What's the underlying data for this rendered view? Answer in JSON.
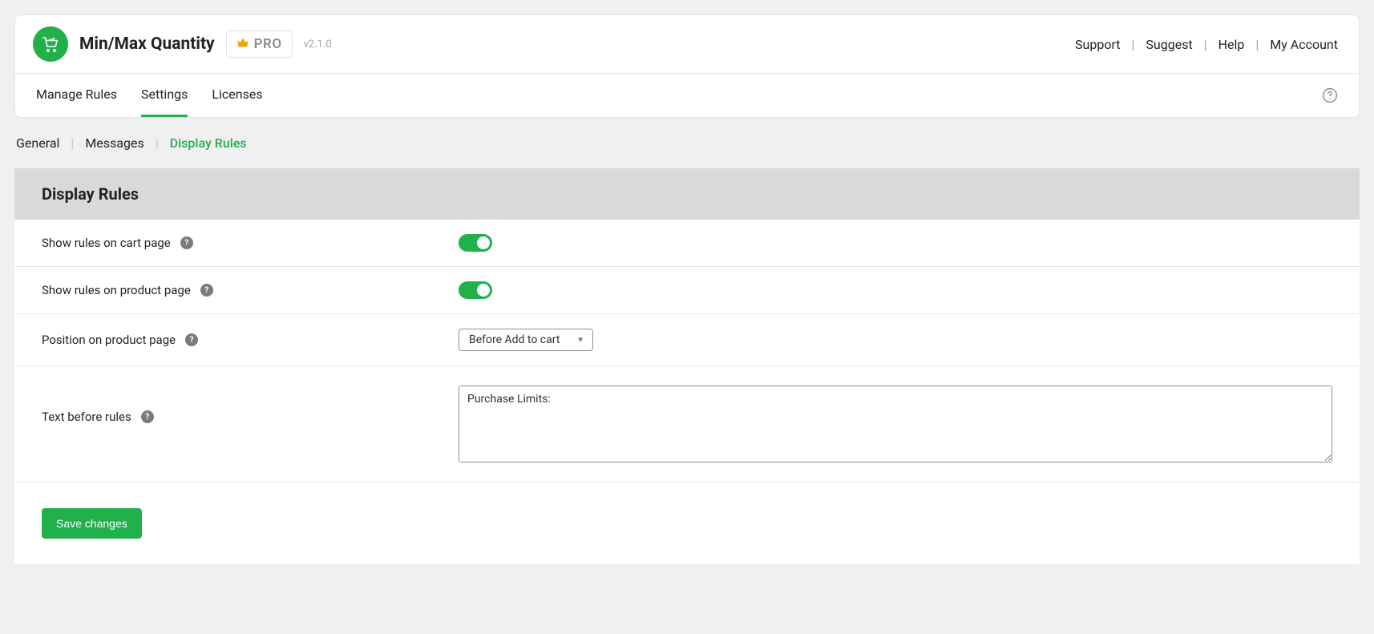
{
  "header": {
    "app_title": "Min/Max Quantity",
    "pro_label": "PRO",
    "version": "v2.1.0",
    "links": {
      "support": "Support",
      "suggest": "Suggest",
      "help": "Help",
      "my_account": "My Account"
    }
  },
  "nav": {
    "manage_rules": "Manage Rules",
    "settings": "Settings",
    "licenses": "Licenses"
  },
  "subnav": {
    "general": "General",
    "messages": "Messages",
    "display_rules": "Display Rules"
  },
  "panel": {
    "title": "Display Rules",
    "show_on_cart": {
      "label": "Show rules on cart page",
      "value": true
    },
    "show_on_product": {
      "label": "Show rules on product page",
      "value": true
    },
    "position": {
      "label": "Position on product page",
      "selected": "Before Add to cart"
    },
    "text_before": {
      "label": "Text before rules",
      "value": "Purchase Limits:"
    },
    "save_label": "Save changes"
  }
}
